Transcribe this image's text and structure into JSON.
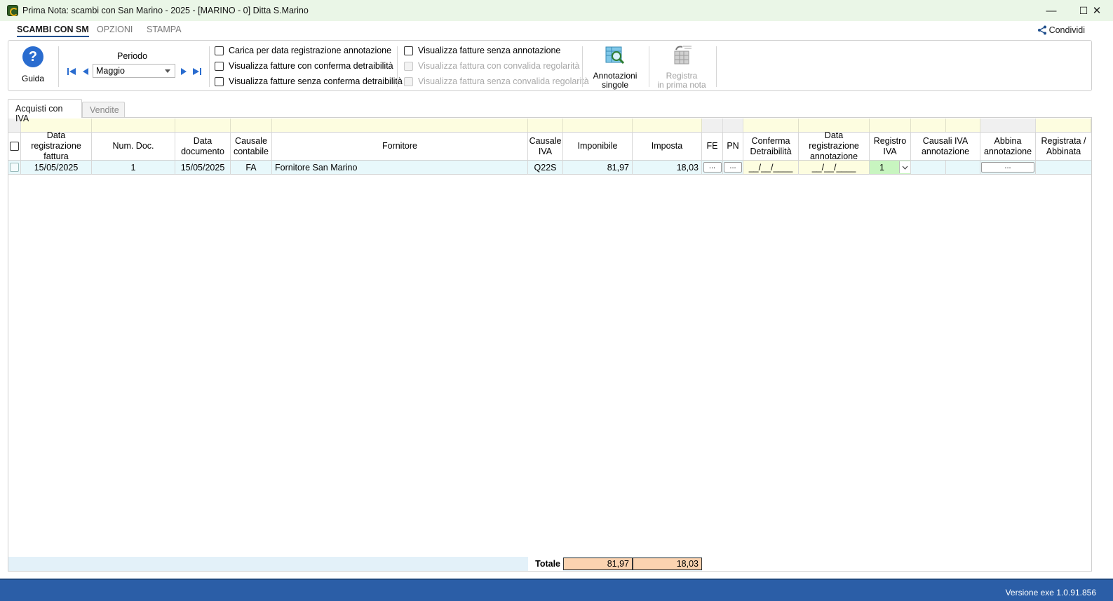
{
  "window": {
    "title": "Prima Nota: scambi con San Marino - 2025 - [MARINO - 0] Ditta S.Marino",
    "minimize": "—",
    "maximize": "☐",
    "close": "✕"
  },
  "ribbon_tabs": [
    "SCAMBI CON SM",
    "OPZIONI",
    "STAMPA"
  ],
  "share_label": "Condividi",
  "ribbon": {
    "guida_label": "Guida",
    "periodo_label": "Periodo",
    "periodo_value": "Maggio",
    "checks_col1": [
      "Carica per data registrazione annotazione",
      "Visualizza fatture con conferma detraibilità",
      "Visualizza fatture senza conferma detraibilità"
    ],
    "checks_col2": [
      "Visualizza fatture senza annotazione",
      "Visualizza fattura con convalida regolarità",
      "Visualizza fattura senza convalida regolarità"
    ],
    "annotazioni_line1": "Annotazioni",
    "annotazioni_line2": "singole",
    "registra_line1": "Registra",
    "registra_line2": "in prima nota"
  },
  "sheet_tabs": [
    "Acquisti con IVA",
    "Vendite"
  ],
  "grid": {
    "headers": {
      "data_reg": [
        "Data registrazione",
        "fattura"
      ],
      "num_doc": [
        "Num. Doc."
      ],
      "data_doc": [
        "Data",
        "documento"
      ],
      "causale_cont": [
        "Causale",
        "contabile"
      ],
      "fornitore": [
        "Fornitore"
      ],
      "causale_iva": [
        "Causale",
        "IVA"
      ],
      "imponibile": [
        "Imponibile"
      ],
      "imposta": [
        "Imposta"
      ],
      "fe": [
        "FE"
      ],
      "pn": [
        "PN"
      ],
      "conferma": [
        "Conferma",
        "Detraibilità"
      ],
      "data_reg_ann": [
        "Data registrazione",
        "annotazione"
      ],
      "registro": [
        "Registro",
        "IVA"
      ],
      "causali_iva_ann": [
        "Causali IVA",
        "annotazione"
      ],
      "abbina": [
        "Abbina",
        "annotazione"
      ],
      "registrata": [
        "Registrata /",
        "Abbinata"
      ]
    },
    "rows": [
      {
        "data_reg": "15/05/2025",
        "num_doc": "1",
        "data_doc": "15/05/2025",
        "causale_cont": "FA",
        "fornitore": "Fornitore San Marino",
        "causale_iva": "Q22S",
        "imponibile": "81,97",
        "imposta": "18,03",
        "fe": "...",
        "pn": "...",
        "conferma": "__/__/____",
        "data_reg_ann": "__/__/____",
        "registro": "1",
        "abbina": "..."
      }
    ],
    "totals": {
      "label": "Totale",
      "imponibile": "81,97",
      "imposta": "18,03"
    }
  },
  "status": {
    "version": "Versione exe 1.0.91.856"
  },
  "colors": {
    "titlebar": "#eaf6e7",
    "statusbar": "#2b5ea7",
    "row_highlight": "#e8f8fb",
    "totals_highlight": "#fbd3b0"
  }
}
